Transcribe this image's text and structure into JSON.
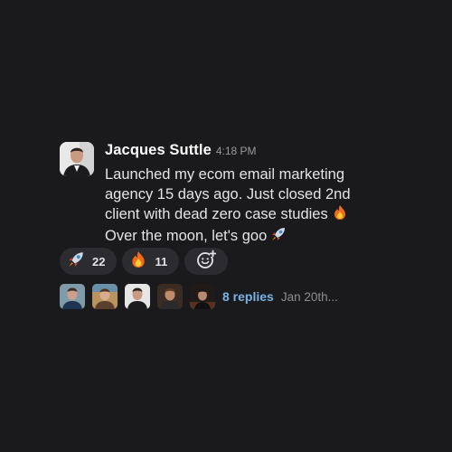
{
  "message": {
    "author": "Jacques Suttle",
    "time": "4:18 PM",
    "lines": [
      "Launched my ecom email marketing",
      "agency 15 days ago. Just closed 2nd",
      "client with dead zero case studies",
      "Over the moon, let's goo"
    ],
    "line3_emoji": "fire-emoji",
    "line4_emoji": "rocket-emoji"
  },
  "reactions": [
    {
      "emoji": "rocket-emoji",
      "count": "22"
    },
    {
      "emoji": "fire-emoji",
      "count": "11"
    }
  ],
  "add_reaction_icon": "add-reaction-icon",
  "thread": {
    "participants": [
      "avatar-1",
      "avatar-2",
      "avatar-3",
      "avatar-4",
      "avatar-5"
    ],
    "replies_label": "8 replies",
    "last_reply": "Jan 20th..."
  },
  "colors": {
    "background": "#1a1a1c",
    "pill": "#2b2b30",
    "link": "#7ab2e6",
    "muted": "#9a9b9e",
    "text": "#e3e4e5"
  }
}
